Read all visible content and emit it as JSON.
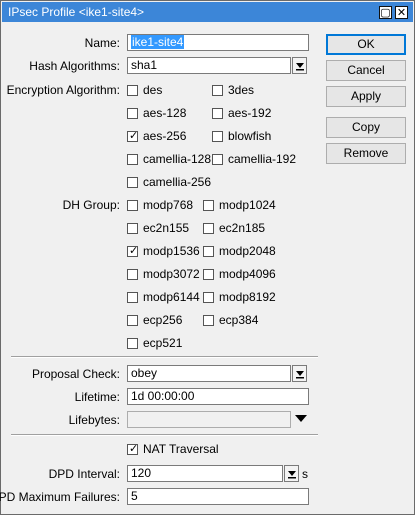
{
  "window": {
    "title": "IPsec Profile <ike1-site4>"
  },
  "labels": {
    "name": "Name:",
    "hash": "Hash Algorithms:",
    "encryption": "Encryption Algorithm:",
    "dh": "DH Group:",
    "proposal": "Proposal Check:",
    "lifetime": "Lifetime:",
    "lifebytes": "Lifebytes:",
    "dpd_interval": "DPD Interval:",
    "dpd_max": "DPD Maximum Failures:"
  },
  "fields": {
    "name": "ike1-site4",
    "hash": "sha1",
    "proposal": "obey",
    "lifetime": "1d 00:00:00",
    "lifebytes": "",
    "dpd_interval": "120",
    "dpd_interval_unit": "s",
    "dpd_max": "5"
  },
  "encryption": [
    {
      "label": "des",
      "checked": false
    },
    {
      "label": "3des",
      "checked": false
    },
    {
      "label": "aes-128",
      "checked": false
    },
    {
      "label": "aes-192",
      "checked": false
    },
    {
      "label": "aes-256",
      "checked": true
    },
    {
      "label": "blowfish",
      "checked": false
    },
    {
      "label": "camellia-128",
      "checked": false
    },
    {
      "label": "camellia-192",
      "checked": false
    },
    {
      "label": "camellia-256",
      "checked": false
    }
  ],
  "dh_groups": [
    {
      "label": "modp768",
      "checked": false
    },
    {
      "label": "modp1024",
      "checked": false
    },
    {
      "label": "ec2n155",
      "checked": false
    },
    {
      "label": "ec2n185",
      "checked": false
    },
    {
      "label": "modp1536",
      "checked": true
    },
    {
      "label": "modp2048",
      "checked": false
    },
    {
      "label": "modp3072",
      "checked": false
    },
    {
      "label": "modp4096",
      "checked": false
    },
    {
      "label": "modp6144",
      "checked": false
    },
    {
      "label": "modp8192",
      "checked": false
    },
    {
      "label": "ecp256",
      "checked": false
    },
    {
      "label": "ecp384",
      "checked": false
    },
    {
      "label": "ecp521",
      "checked": false
    }
  ],
  "nat_traversal": {
    "label": "NAT Traversal",
    "checked": true
  },
  "buttons": {
    "ok": "OK",
    "cancel": "Cancel",
    "apply": "Apply",
    "copy": "Copy",
    "remove": "Remove"
  },
  "icons": {
    "restore": "restore-icon",
    "close": "close-icon",
    "dropdown": "dropdown-arrow-icon",
    "check": "checkmark-icon"
  }
}
